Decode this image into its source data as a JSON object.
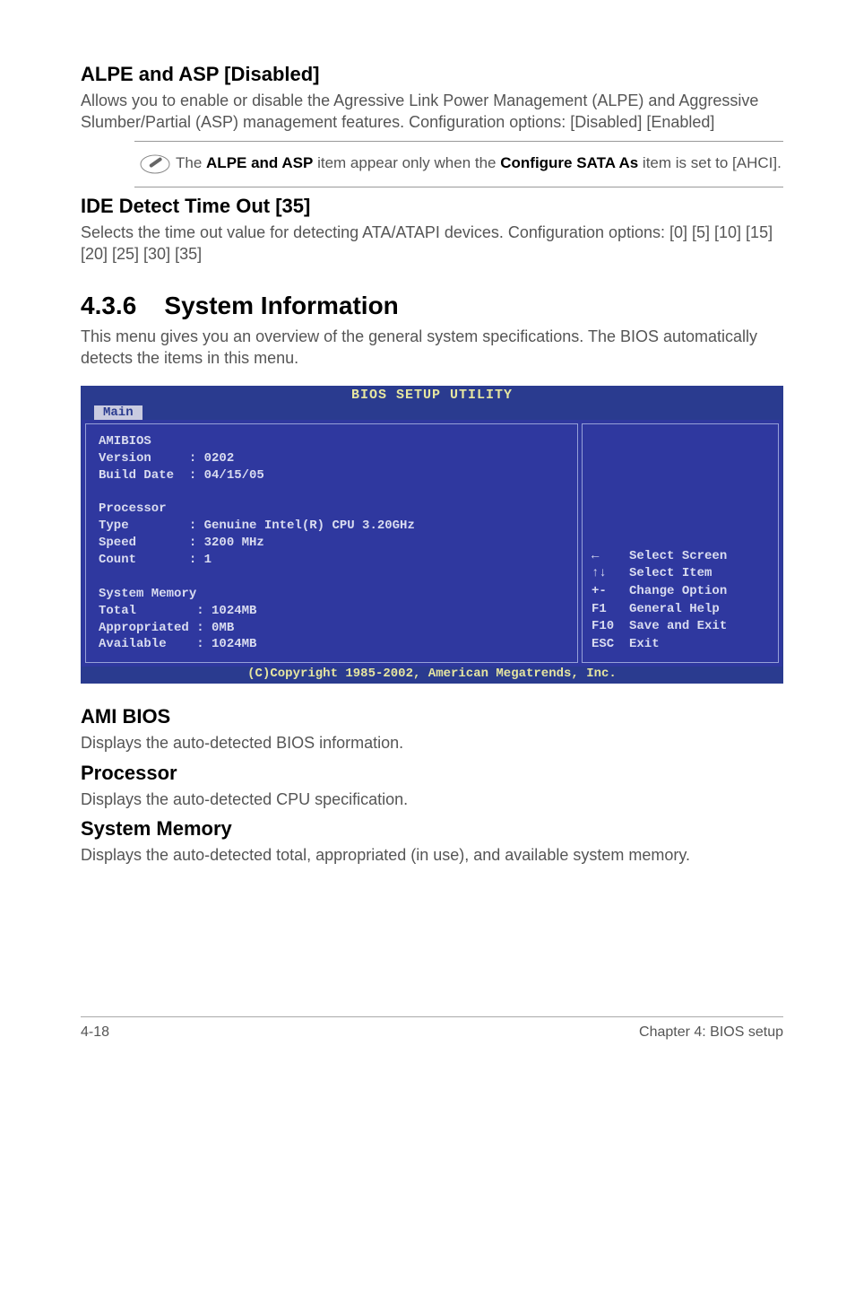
{
  "sec1": {
    "heading": "ALPE and ASP [Disabled]",
    "p1": "Allows you to enable or disable the Agressive Link Power Management (ALPE) and Aggressive Slumber/Partial (ASP) management features. Configuration options: [Disabled] [Enabled]"
  },
  "note": {
    "prefix": "The ",
    "b1": "ALPE and ASP",
    "mid": " item appear only when the ",
    "b2": "Configure SATA As",
    "suffix": " item is set to [AHCI]."
  },
  "sec2": {
    "heading": "IDE Detect Time Out [35]",
    "p1": "Selects the time out value for detecting ATA/ATAPI devices. Configuration options: [0] [5] [10] [15] [20] [25] [30] [35]"
  },
  "sec3": {
    "num": "4.3.6",
    "title": "System Information",
    "p1": "This menu gives you an overview of the general system specifications. The BIOS automatically detects the items in this menu."
  },
  "bios": {
    "title": "BIOS SETUP UTILITY",
    "tab": "Main",
    "left": "AMIBIOS\nVersion     : 0202\nBuild Date  : 04/15/05\n\nProcessor\nType        : Genuine Intel(R) CPU 3.20GHz\nSpeed       : 3200 MHz\nCount       : 1\n\nSystem Memory\nTotal        : 1024MB\nAppropriated : 0MB\nAvailable    : 1024MB",
    "right": "←    Select Screen\n↑↓   Select Item\n+-   Change Option\nF1   General Help\nF10  Save and Exit\nESC  Exit",
    "footer": "(C)Copyright 1985-2002, American Megatrends, Inc."
  },
  "sec4": {
    "heading": "AMI BIOS",
    "p1": "Displays the auto-detected BIOS information."
  },
  "sec5": {
    "heading": "Processor",
    "p1": "Displays the auto-detected CPU specification."
  },
  "sec6": {
    "heading": "System Memory",
    "p1": "Displays the auto-detected total, appropriated (in use), and available system memory."
  },
  "footer": {
    "left": "4-18",
    "right": "Chapter 4: BIOS setup"
  }
}
